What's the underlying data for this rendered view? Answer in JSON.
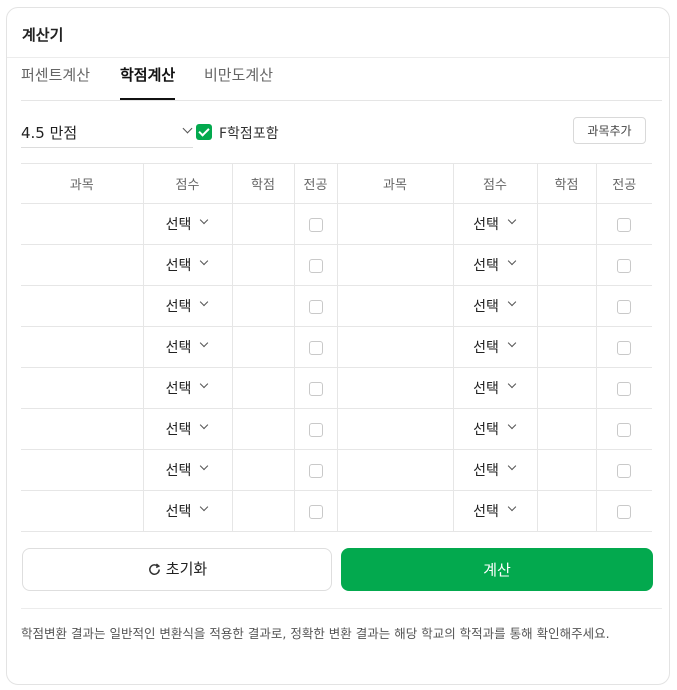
{
  "card": {
    "title": "계산기"
  },
  "tabs": [
    {
      "label": "퍼센트계산",
      "active": false
    },
    {
      "label": "학점계산",
      "active": true
    },
    {
      "label": "비만도계산",
      "active": false
    }
  ],
  "controls": {
    "scale_value": "4.5 만점",
    "include_f_label": "F학점포함",
    "include_f_checked": true,
    "add_subject_label": "과목추가"
  },
  "table": {
    "headers": [
      "과목",
      "점수",
      "학점",
      "전공",
      "과목",
      "점수",
      "학점",
      "전공"
    ],
    "grade_placeholder": "선택",
    "row_count": 8
  },
  "buttons": {
    "reset_label": "초기화",
    "calculate_label": "계산"
  },
  "notice": "학점변환 결과는 일반적인 변환식을 적용한 결과로, 정확한 변환 결과는 해당 학교의 학적과를 통해 확인해주세요.",
  "colors": {
    "accent": "#03a94e",
    "border": "#e6e6e6"
  },
  "icons": {
    "reset": "refresh-icon",
    "select": "chevron-down-icon",
    "checkbox": "check-icon"
  }
}
